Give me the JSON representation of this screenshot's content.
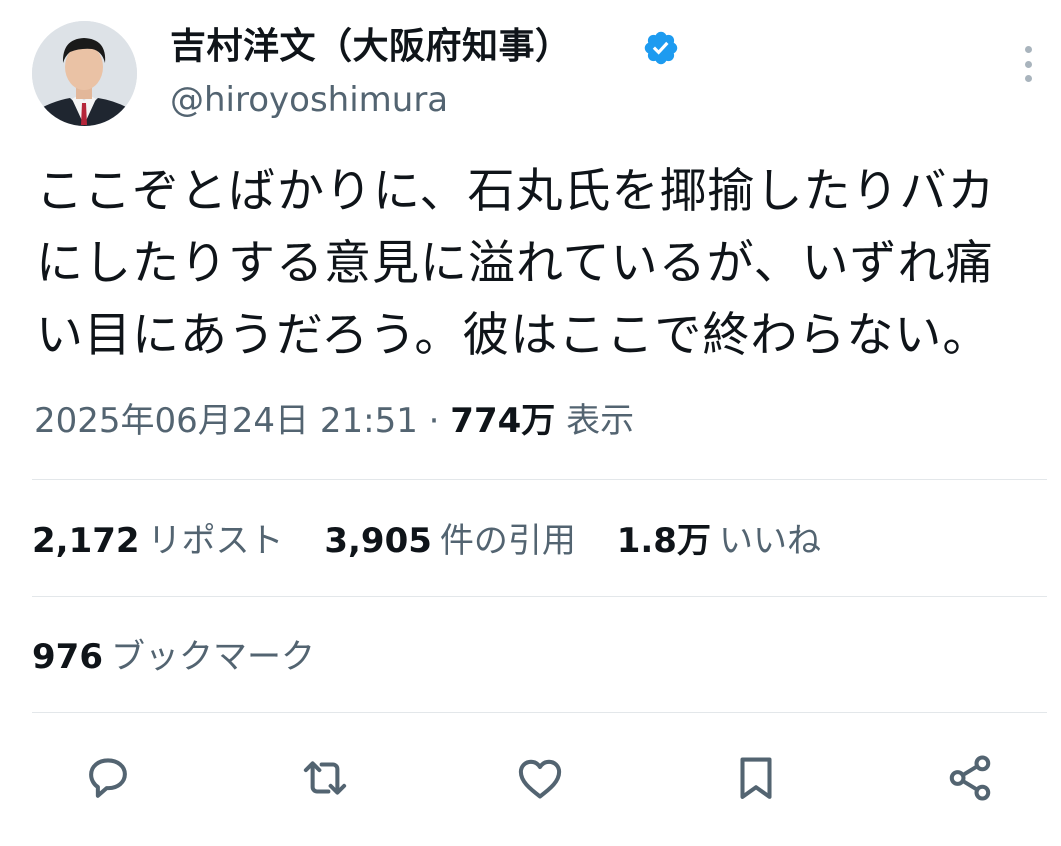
{
  "author": {
    "display_name": "吉村洋文（大阪府知事）",
    "handle": "@hiroyoshimura",
    "verified": true,
    "verified_color": "#1d9bf0"
  },
  "tweet": {
    "lines": [
      "ここぞとばかりに、石丸氏を揶揄したりバカ",
      "にしたりする意見に溢れているが、いずれ痛",
      "い目にあうだろう。彼はここで終わらない。"
    ]
  },
  "meta": {
    "timestamp": "2025年06月24日 21:51",
    "separator": "·",
    "views_count": "774万",
    "views_label": "表示"
  },
  "stats": {
    "reposts": {
      "count": "2,172",
      "label": "リポスト"
    },
    "quotes": {
      "count": "3,905",
      "label": "件の引用"
    },
    "likes": {
      "count": "1.8万",
      "label": "いいね"
    },
    "bookmarks": {
      "count": "976",
      "label": "ブックマーク"
    }
  },
  "actions": {
    "reply_icon": "reply-icon",
    "repost_icon": "repost-icon",
    "like_icon": "heart-icon",
    "bookmark_icon": "bookmark-icon",
    "share_icon": "share-icon",
    "icon_color": "#536471"
  }
}
